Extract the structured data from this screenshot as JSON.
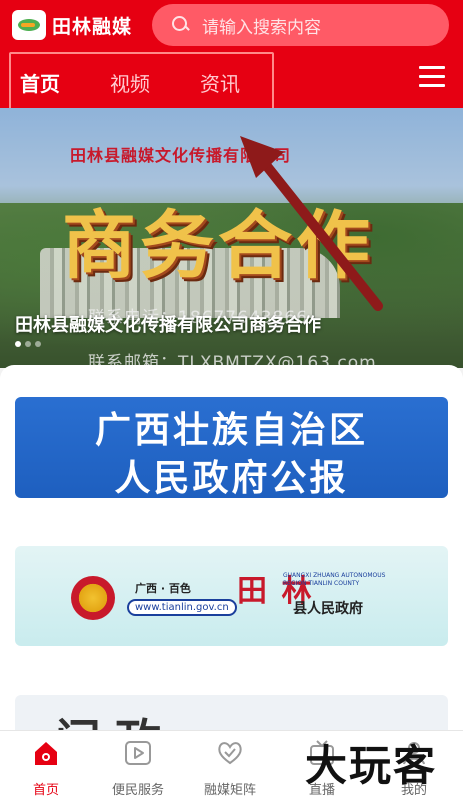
{
  "header": {
    "logo_text": "田林融媒",
    "search_placeholder": "请输入搜索内容",
    "tabs": [
      {
        "label": "首页",
        "active": true
      },
      {
        "label": "视频",
        "active": false
      },
      {
        "label": "资讯",
        "active": false
      }
    ]
  },
  "banner": {
    "company_line": "田林县融媒文化传播有限公司",
    "headline": "商务合作",
    "phone_line": "联系电话：18677643866",
    "email_line": "联系邮箱：TLXBMTZX@163.com",
    "caption": "田林县融媒文化传播有限公司商务合作"
  },
  "cards": {
    "card1_line1": "广西壮族自治区",
    "card1_line2": "人民政府公报",
    "card2_region": "广西 · 百色",
    "card2_url": "www.tianlin.gov.cn",
    "card2_big": "田 林",
    "card2_english": "GUANGXI ZHUANG AUTONOMOUS REGION TIANLIN COUNTY",
    "card2_gov": "县人民政府",
    "card3_text": "问政"
  },
  "bottom_nav": [
    {
      "label": "首页",
      "icon": "home-icon",
      "active": true
    },
    {
      "label": "便民服务",
      "icon": "play-icon",
      "active": false
    },
    {
      "label": "融媒矩阵",
      "icon": "heart-icon",
      "active": false
    },
    {
      "label": "直播",
      "icon": "live-icon",
      "active": false
    },
    {
      "label": "我的",
      "icon": "user-icon",
      "active": false
    }
  ],
  "watermark": "大玩客",
  "colors": {
    "brand_red": "#e60012",
    "search_bg": "#ff5a66",
    "card1_blue": "#2a6fd1"
  }
}
